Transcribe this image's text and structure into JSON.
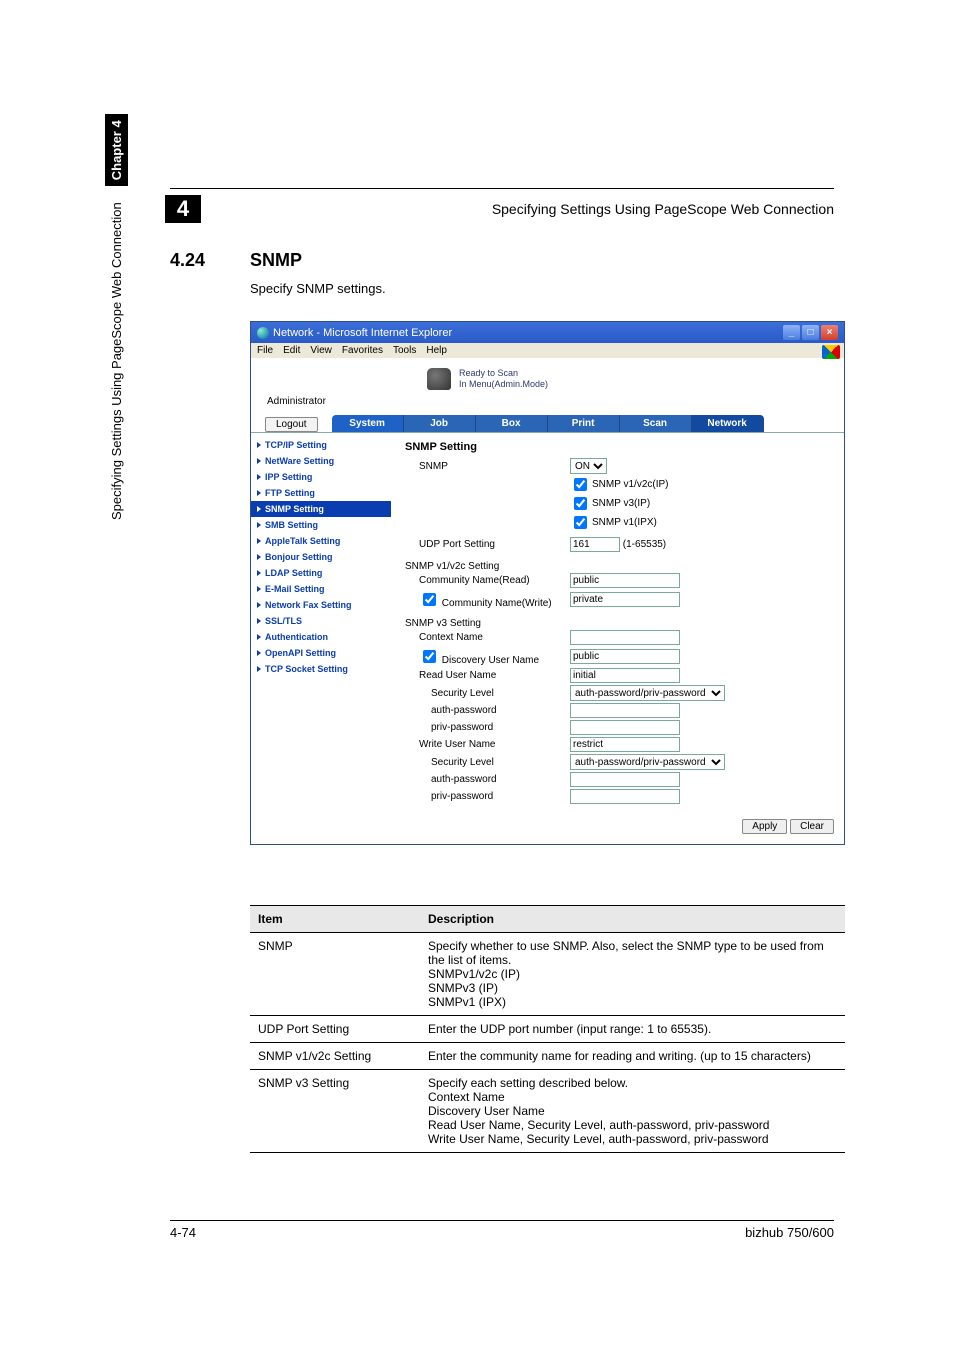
{
  "header": {
    "chapter_number": "4",
    "title": "Specifying Settings Using PageScope Web Connection"
  },
  "section": {
    "number": "4.24",
    "title": "SNMP",
    "intro": "Specify SNMP settings."
  },
  "browser": {
    "title": "Network - Microsoft Internet Explorer",
    "win_min": "_",
    "win_max": "□",
    "win_close": "×",
    "menus": [
      "File",
      "Edit",
      "View",
      "Favorites",
      "Tools",
      "Help"
    ],
    "banner_line1": "Ready to Scan",
    "banner_line2": "In Menu(Admin.Mode)",
    "admin_label": "Administrator",
    "logout": "Logout",
    "tabs": [
      "System",
      "Job",
      "Box",
      "Print",
      "Scan",
      "Network"
    ],
    "active_tab": 5,
    "sidenav": [
      "TCP/IP Setting",
      "NetWare Setting",
      "IPP Setting",
      "FTP Setting",
      "SNMP Setting",
      "SMB Setting",
      "AppleTalk Setting",
      "Bonjour Setting",
      "LDAP Setting",
      "E-Mail Setting",
      "Network Fax Setting",
      "SSL/TLS",
      "Authentication",
      "OpenAPI Setting",
      "TCP Socket Setting"
    ],
    "active_sidenav": 4,
    "form": {
      "heading": "SNMP Setting",
      "snmp_label": "SNMP",
      "snmp_select": "ON",
      "chk1_label": "SNMP v1/v2c(IP)",
      "chk2_label": "SNMP v3(IP)",
      "chk3_label": "SNMP v1(IPX)",
      "udp_label": "UDP Port Setting",
      "udp_value": "161",
      "udp_range": "(1-65535)",
      "v12_heading": "SNMP v1/v2c Setting",
      "comm_read_label": "Community Name(Read)",
      "comm_read_value": "public",
      "comm_write_check": "Community Name(Write)",
      "comm_write_value": "private",
      "v3_heading": "SNMP v3 Setting",
      "context_label": "Context Name",
      "context_value": "",
      "disc_user_check": "Discovery User Name",
      "disc_user_value": "public",
      "read_user_label": "Read User Name",
      "read_user_value": "initial",
      "sec_level_label": "Security Level",
      "sec_level_value": "auth-password/priv-password",
      "auth_pw_label": "auth-password",
      "auth_pw_value": "",
      "priv_pw_label": "priv-password",
      "priv_pw_value": "",
      "write_user_label": "Write User Name",
      "write_user_value": "restrict",
      "sec_level2_value": "auth-password/priv-password",
      "auth_pw2_value": "",
      "priv_pw2_value": "",
      "apply": "Apply",
      "clear": "Clear"
    }
  },
  "desc_table": {
    "head_item": "Item",
    "head_desc": "Description",
    "rows": [
      {
        "item": "SNMP",
        "desc": "Specify whether to use SNMP. Also, select the SNMP type to be used from the list of items.\nSNMPv1/v2c (IP)\nSNMPv3 (IP)\nSNMPv1 (IPX)"
      },
      {
        "item": "UDP Port Setting",
        "desc": "Enter the UDP port number (input range: 1 to 65535)."
      },
      {
        "item": "SNMP v1/v2c Setting",
        "desc": "Enter the community name for reading and writing. (up to 15 characters)"
      },
      {
        "item": "SNMP v3 Setting",
        "desc": "Specify each setting described below.\nContext Name\nDiscovery User Name\nRead User Name, Security Level, auth-password, priv-password\nWrite User Name, Security Level, auth-password, priv-password"
      }
    ]
  },
  "side": {
    "running": "Specifying Settings Using PageScope Web Connection",
    "chapter": "Chapter 4"
  },
  "footer": {
    "page": "4-74",
    "model": "bizhub 750/600"
  }
}
